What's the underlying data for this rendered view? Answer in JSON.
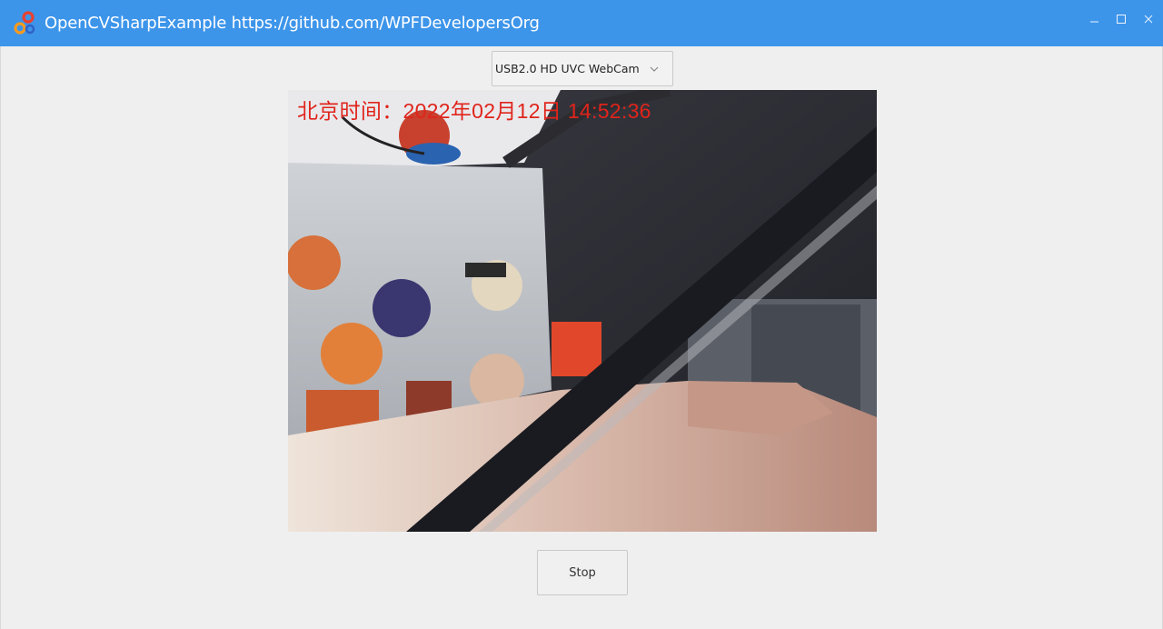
{
  "window": {
    "title": "OpenCVSharpExample https://github.com/WPFDevelopersOrg",
    "icon": "opencv-logo",
    "controls": [
      "minimize-icon",
      "maximize-icon",
      "close-icon"
    ],
    "accent_color": "#3d95ea"
  },
  "camera_select": {
    "selected": "USB2.0 HD UVC WebCam",
    "icon": "chevron-down-icon"
  },
  "video": {
    "overlay_text": "北京时间：2022年02月12日 14:52:36",
    "overlay_color": "#e0241b"
  },
  "controls": {
    "stop_label": "Stop"
  }
}
